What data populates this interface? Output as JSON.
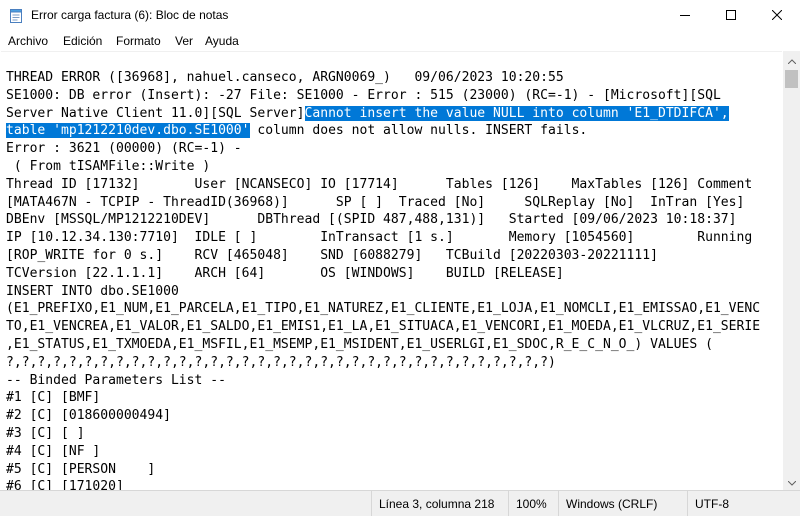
{
  "window": {
    "title": "Error carga factura (6): Bloc de notas",
    "app_icon": "notepad-icon"
  },
  "menu": {
    "items": [
      "Archivo",
      "Edición",
      "Formato",
      "Ver",
      "Ayuda"
    ]
  },
  "editor": {
    "lines": [
      "THREAD ERROR ([36968], nahuel.canseco, ARGN0069_)   09/06/2023 10:20:55",
      "SE1000: DB error (Insert): -27 File: SE1000 - Error : 515 (23000) (RC=-1) - [Microsoft][SQL",
      "Server Native Client 11.0][SQL Server]",
      "table 'mp1212210dev.dbo.SE1000'",
      "Error : 3621 (00000) (RC=-1) -",
      " ( From tISAMFile::Write )",
      "Thread ID [17132]       User [NCANSECO] IO [17714]      Tables [126]    MaxTables [126] Comment",
      "[MATA467N - TCPIP - ThreadID(36968)]      SP [ ]  Traced [No]     SQLReplay [No]  InTran [Yes]",
      "DBEnv [MSSQL/MP1212210DEV]      DBThread [(SPID 487,488,131)]   Started [09/06/2023 10:18:37]",
      "IP [10.12.34.130:7710]  IDLE [ ]        InTransact [1 s.]       Memory [1054560]        Running",
      "[ROP_WRITE for 0 s.]    RCV [465048]    SND [6088279]   TCBuild [20220303-20221111]",
      "TCVersion [22.1.1.1]    ARCH [64]       OS [WINDOWS]    BUILD [RELEASE]",
      "INSERT INTO dbo.SE1000",
      "(E1_PREFIXO,E1_NUM,E1_PARCELA,E1_TIPO,E1_NATUREZ,E1_CLIENTE,E1_LOJA,E1_NOMCLI,E1_EMISSAO,E1_VENC",
      "TO,E1_VENCREA,E1_VALOR,E1_SALDO,E1_EMIS1,E1_LA,E1_SITUACA,E1_VENCORI,E1_MOEDA,E1_VLCRUZ,E1_SERIE",
      ",E1_STATUS,E1_TXMOEDA,E1_MSFIL,E1_MSEMP,E1_MSIDENT,E1_USERLGI,E1_SDOC,R_E_C_N_O_) VALUES (",
      "?,?,?,?,?,?,?,?,?,?,?,?,?,?,?,?,?,?,?,?,?,?,?,?,?,?,?,?,?,?,?,?,?,?,?)",
      "-- Binded Parameters List --",
      "#1 [C] [BMF]",
      "#2 [C] [018600000494]",
      "#3 [C] [ ]",
      "#4 [C] [NF ]",
      "#5 [C] [PERSON    ]",
      "#6 [C] [171020]"
    ],
    "selected_part_1": "Cannot insert the value NULL into column 'E1_DTDIFCA',",
    "selected_part_2": " column does not allow nulls. INSERT fails.",
    "selection_color": "#0078d7"
  },
  "status": {
    "position": "Línea 3, columna 218",
    "zoom": "100%",
    "line_ending": "Windows (CRLF)",
    "encoding": "UTF-8"
  }
}
